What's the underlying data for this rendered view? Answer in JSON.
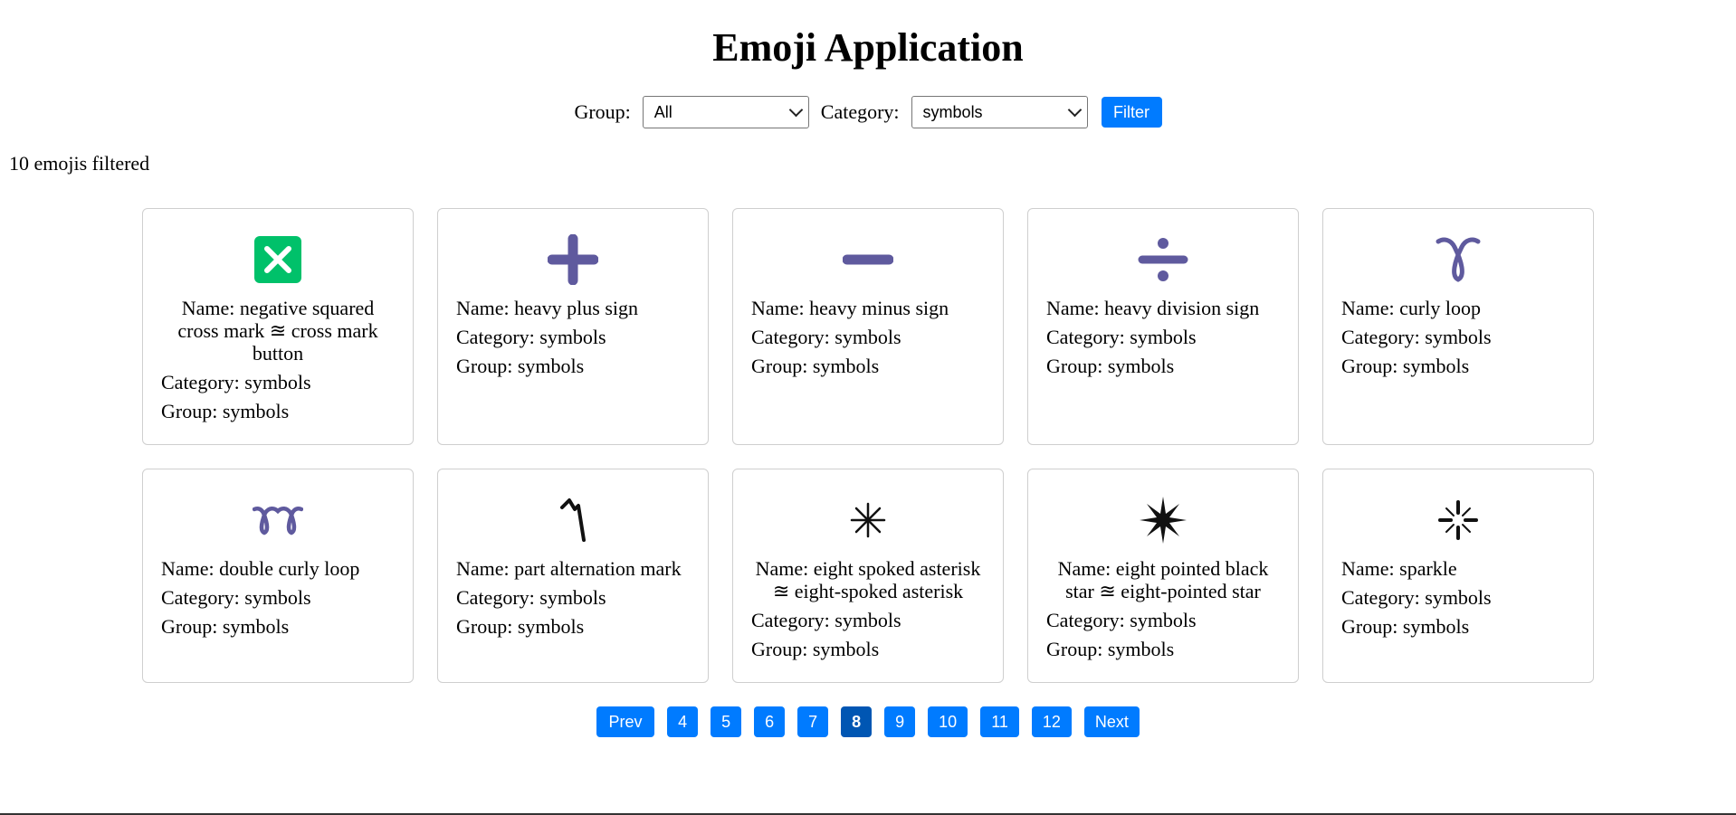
{
  "title": "Emoji Application",
  "filters": {
    "group_label": "Group:",
    "group_value": "All",
    "category_label": "Category:",
    "category_value": "symbols",
    "filter_button": "Filter"
  },
  "count_text": "10 emojis filtered",
  "emojis": [
    {
      "icon": "cross-mark-button-icon",
      "name": "Name: negative squared cross mark ≊ cross mark button",
      "category": "Category: symbols",
      "group": "Group: symbols"
    },
    {
      "icon": "heavy-plus-icon",
      "name": "Name: heavy plus sign",
      "category": "Category: symbols",
      "group": "Group: symbols"
    },
    {
      "icon": "heavy-minus-icon",
      "name": "Name: heavy minus sign",
      "category": "Category: symbols",
      "group": "Group: symbols"
    },
    {
      "icon": "heavy-division-icon",
      "name": "Name: heavy division sign",
      "category": "Category: symbols",
      "group": "Group: symbols"
    },
    {
      "icon": "curly-loop-icon",
      "name": "Name: curly loop",
      "category": "Category: symbols",
      "group": "Group: symbols"
    },
    {
      "icon": "double-curly-loop-icon",
      "name": "Name: double curly loop",
      "category": "Category: symbols",
      "group": "Group: symbols"
    },
    {
      "icon": "part-alternation-mark-icon",
      "name": "Name: part alternation mark",
      "category": "Category: symbols",
      "group": "Group: symbols"
    },
    {
      "icon": "eight-spoked-asterisk-icon",
      "name": "Name: eight spoked asterisk ≊ eight-spoked asterisk",
      "category": "Category: symbols",
      "group": "Group: symbols"
    },
    {
      "icon": "eight-pointed-star-icon",
      "name": "Name: eight pointed black star ≊ eight-pointed star",
      "category": "Category: symbols",
      "group": "Group: symbols"
    },
    {
      "icon": "sparkle-icon",
      "name": "Name: sparkle",
      "category": "Category: symbols",
      "group": "Group: symbols"
    }
  ],
  "pagination": {
    "prev": "Prev",
    "pages": [
      "4",
      "5",
      "6",
      "7",
      "8",
      "9",
      "10",
      "11",
      "12"
    ],
    "current": "8",
    "next": "Next"
  },
  "colors": {
    "accent": "#007bff",
    "active_page": "#0056b3",
    "symbol_purple": "#5f5a9e",
    "cross_green": "#00c16a"
  }
}
